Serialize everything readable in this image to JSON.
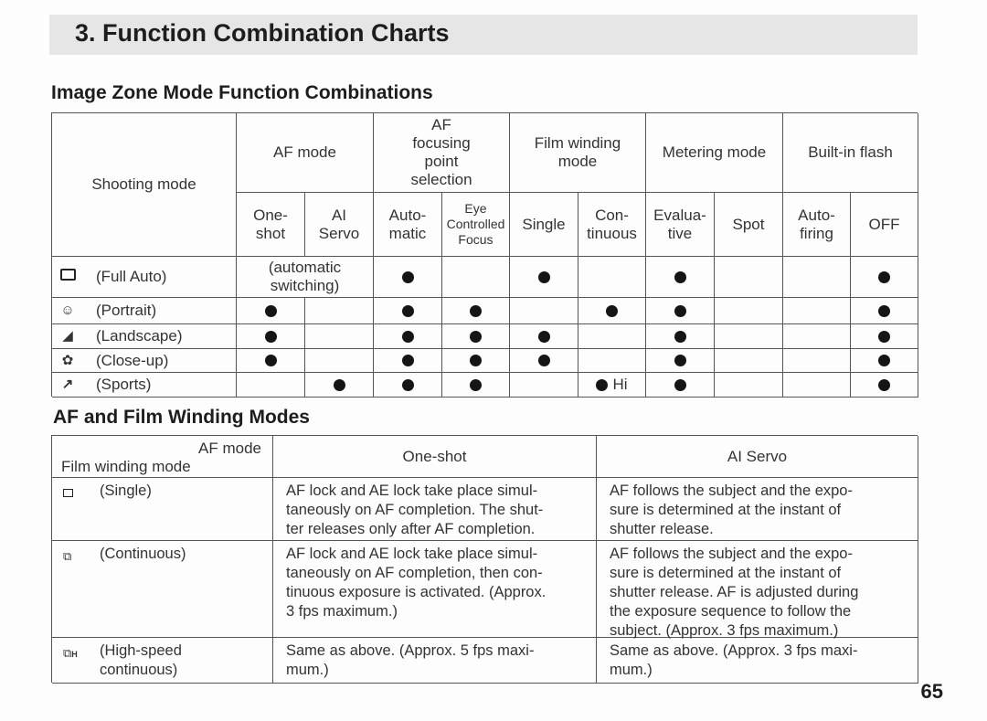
{
  "page": {
    "title": "3. Function Combination Charts",
    "page_number": "65"
  },
  "image_zone": {
    "heading": "Image Zone Mode Function Combinations",
    "headers": {
      "shooting_mode": "Shooting mode",
      "af_mode": "AF mode",
      "af_point": [
        "AF",
        "focusing",
        "point",
        "selection"
      ],
      "film_winding": [
        "Film winding",
        "mode"
      ],
      "metering": "Metering mode",
      "flash": "Built-in flash"
    },
    "subheaders": [
      [
        "One-",
        "shot"
      ],
      [
        "AI",
        "Servo"
      ],
      [
        "Auto-",
        "matic"
      ],
      [
        "Eye",
        "Controlled",
        "Focus"
      ],
      [
        "Single"
      ],
      [
        "Con-",
        "tinuous"
      ],
      [
        "Evalua-",
        "tive"
      ],
      [
        "Spot"
      ],
      [
        "Auto-",
        "firing"
      ],
      [
        "OFF"
      ]
    ],
    "auto_switching": [
      "(automatic",
      "switching)"
    ],
    "rows": [
      {
        "icon": "full-auto-icon",
        "label": "(Full Auto)",
        "marks": [
          null,
          null,
          true,
          false,
          true,
          false,
          true,
          false,
          false,
          true
        ],
        "af_merged": true
      },
      {
        "icon": "portrait-icon",
        "label": "(Portrait)",
        "marks": [
          true,
          false,
          true,
          true,
          false,
          true,
          true,
          false,
          false,
          true
        ]
      },
      {
        "icon": "landscape-icon",
        "label": "(Landscape)",
        "marks": [
          true,
          false,
          true,
          true,
          true,
          false,
          true,
          false,
          false,
          true
        ]
      },
      {
        "icon": "close-up-icon",
        "label": "(Close-up)",
        "marks": [
          true,
          false,
          true,
          true,
          true,
          false,
          true,
          false,
          false,
          true
        ]
      },
      {
        "icon": "sports-icon",
        "label": "(Sports)",
        "marks": [
          false,
          true,
          true,
          true,
          false,
          "Hi",
          true,
          false,
          false,
          true
        ]
      }
    ]
  },
  "af_winding": {
    "heading": "AF and Film Winding Modes",
    "corner_top": "AF mode",
    "corner_bottom": "Film winding mode",
    "columns": [
      "One-shot",
      "AI Servo"
    ],
    "rows": [
      {
        "icon": "single-frame-icon",
        "label": [
          "(Single)"
        ],
        "one_shot": [
          "AF lock and AE lock take place simul-",
          "taneously on AF completion. The shut-",
          "ter releases only after AF completion."
        ],
        "ai_servo": [
          "AF follows the subject and the expo-",
          "sure is determined at the instant of",
          "shutter release."
        ]
      },
      {
        "icon": "continuous-icon",
        "label": [
          "(Continuous)"
        ],
        "one_shot": [
          "AF lock and AE lock take place simul-",
          "taneously on AF completion, then con-",
          "tinuous exposure is activated. (Approx.",
          "3 fps maximum.)"
        ],
        "ai_servo": [
          "AF follows the subject and the expo-",
          "sure is determined at the instant of",
          "shutter release. AF is adjusted during",
          "the exposure sequence to follow the",
          "subject. (Approx. 3 fps maximum.)"
        ]
      },
      {
        "icon": "high-speed-continuous-icon",
        "label": [
          "(High-speed",
          "continuous)"
        ],
        "one_shot": [
          "Same as above. (Approx. 5 fps maxi-",
          "mum.)"
        ],
        "ai_servo": [
          "Same as above. (Approx. 3 fps maxi-",
          "mum.)"
        ]
      }
    ]
  }
}
